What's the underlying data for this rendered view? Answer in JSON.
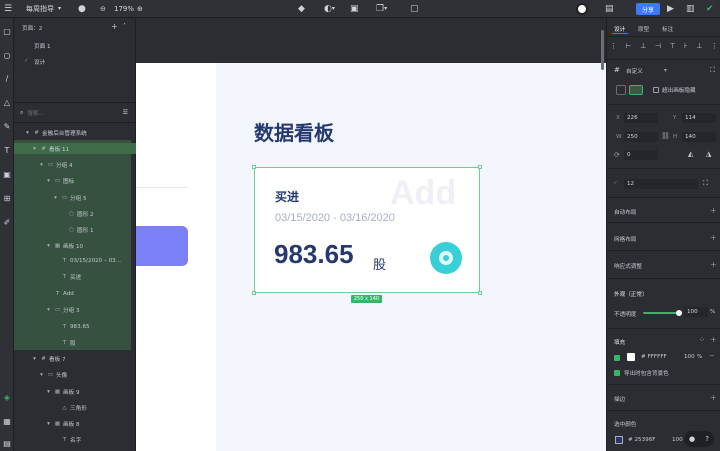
{
  "topbar": {
    "project_name": "每周指导",
    "zoom": "179%",
    "share_label": "分享"
  },
  "pages": {
    "title": "页面：2",
    "items": [
      "页面 1",
      "设计"
    ]
  },
  "layers": {
    "search_placeholder": "搜索...",
    "rows": [
      {
        "label": "金融后台管理系统",
        "glyph": "#"
      },
      {
        "label": "看板 11",
        "glyph": "#"
      },
      {
        "label": "分组 4",
        "glyph": "▭"
      },
      {
        "label": "图标",
        "glyph": "▭"
      },
      {
        "label": "分组 5",
        "glyph": "▭"
      },
      {
        "label": "圆形 2",
        "glyph": "○"
      },
      {
        "label": "圆形 1",
        "glyph": "○"
      },
      {
        "label": "画板 10",
        "glyph": "▦"
      },
      {
        "label": "03/15/2020 – 03...",
        "glyph": "T"
      },
      {
        "label": "买进",
        "glyph": "T"
      },
      {
        "label": "Add",
        "glyph": "T"
      },
      {
        "label": "分组 3",
        "glyph": "▭"
      },
      {
        "label": "983.65",
        "glyph": "T"
      },
      {
        "label": "股",
        "glyph": "T"
      },
      {
        "label": "看板 7",
        "glyph": "#"
      },
      {
        "label": "头像",
        "glyph": "▭"
      },
      {
        "label": "画板 9",
        "glyph": "▦"
      },
      {
        "label": "三角形",
        "glyph": "△"
      },
      {
        "label": "画板 8",
        "glyph": "▦"
      },
      {
        "label": "名字",
        "glyph": "T"
      }
    ]
  },
  "canvas": {
    "heading": "数据看板",
    "card": {
      "title": "买进",
      "date_range": "03/15/2020 - 03/16/2020",
      "watermark": "Add",
      "value": "983.65",
      "unit": "股"
    },
    "size_tag": "250 x 140"
  },
  "properties": {
    "tabs": [
      "设计",
      "原型",
      "标注"
    ],
    "preset": "自定义",
    "clip_label": "超出画板隐藏",
    "x": "226",
    "y": "114",
    "w": "250",
    "h": "140",
    "rotation": "0",
    "radius": "12",
    "auto_layout": "自动布局",
    "grid_layout": "网格布局",
    "responsive": "响应式调整",
    "appearance": "外观（正常）",
    "opacity_label": "不透明度",
    "opacity_value": "100",
    "fill_title": "填充",
    "fill_hex": "FFFFFF",
    "fill_opacity": "100",
    "fill_unit": "%",
    "export_bg_label": "导出时包含背景色",
    "stroke_title": "描边",
    "selected_color_title": "选中颜色",
    "selected_hex": "25396F",
    "selected_opacity": "100"
  },
  "colors": {
    "accent": "#3d7bf5",
    "selection": "#6fcf8f",
    "heading": "#25396f",
    "card_button": "#7b80f7",
    "fab": "#38d0d6"
  }
}
